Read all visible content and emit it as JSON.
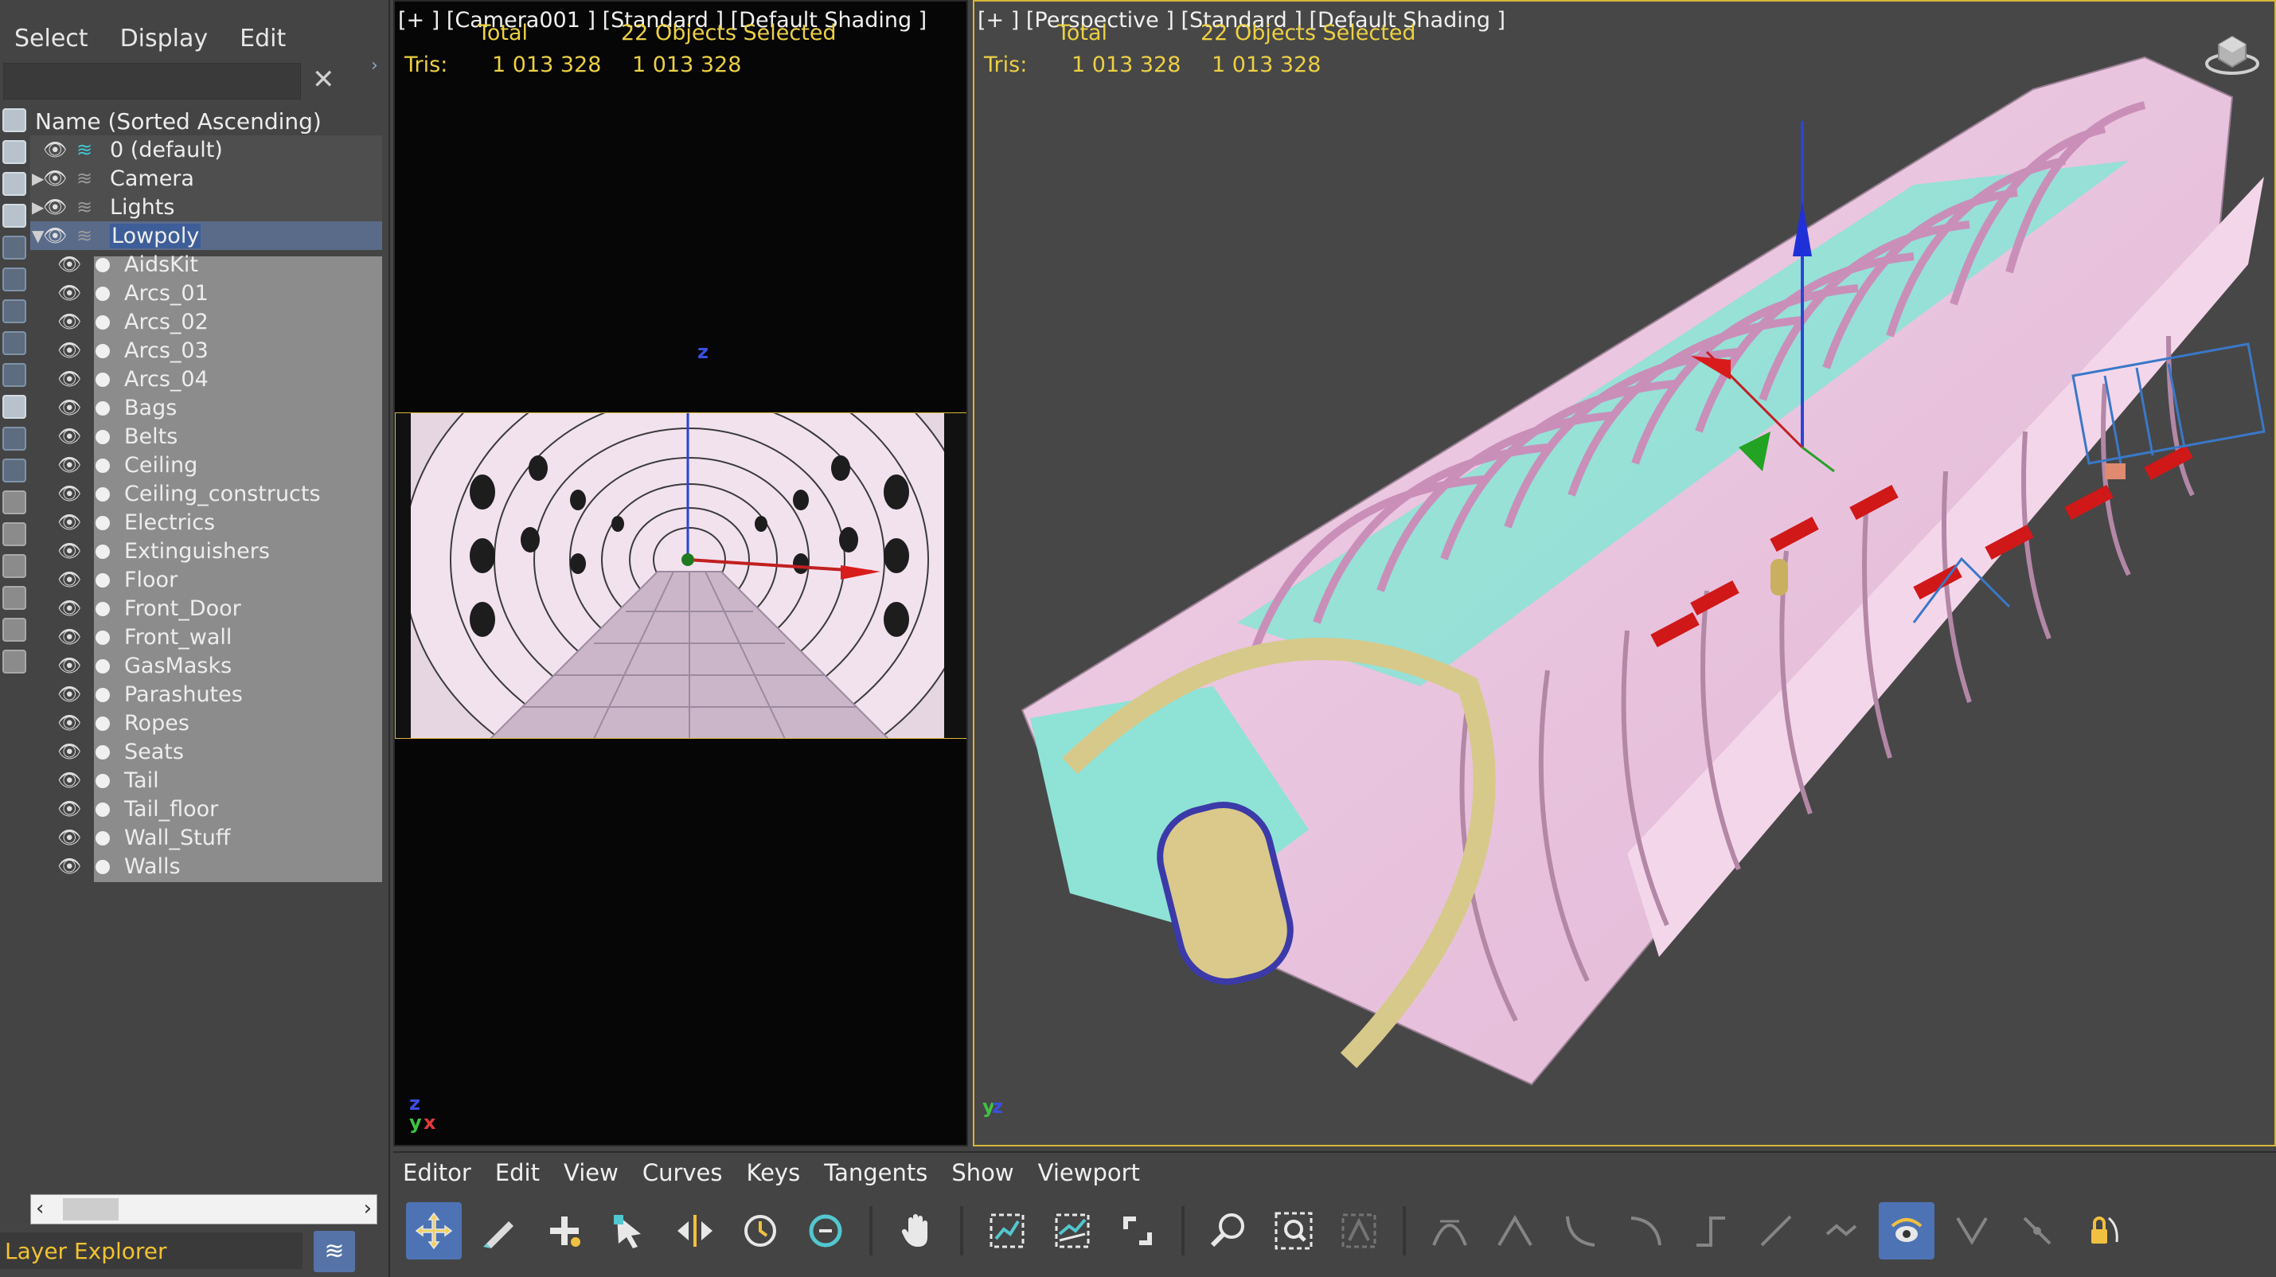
{
  "explorer": {
    "menu": [
      "Select",
      "Display",
      "Edit"
    ],
    "search_value": "",
    "header": "Name (Sorted Ascending)",
    "layers": [
      {
        "name": "0 (default)",
        "kind": "default"
      },
      {
        "name": "Camera",
        "kind": "collapsed"
      },
      {
        "name": "Lights",
        "kind": "collapsed"
      },
      {
        "name": "Lowpoly",
        "kind": "expanded",
        "selected": true
      }
    ],
    "objects": [
      "AidsKit",
      "Arcs_01",
      "Arcs_02",
      "Arcs_03",
      "Arcs_04",
      "Bags",
      "Belts",
      "Ceiling",
      "Ceiling_constructs",
      "Electrics",
      "Extinguishers",
      "Floor",
      "Front_Door",
      "Front_wall",
      "GasMasks",
      "Parashutes",
      "Ropes",
      "Seats",
      "Tail",
      "Tail_floor",
      "Wall_Stuff",
      "Walls"
    ],
    "footer_label": "Layer Explorer",
    "tool_icons": [
      "geometry-filter-icon",
      "shapes-filter-icon",
      "lights-filter-icon",
      "cameras-filter-icon",
      "helpers-filter-icon",
      "spacewarps-filter-icon",
      "groups-filter-icon",
      "xrefs-filter-icon",
      "bones-filter-icon",
      "containers-filter-icon",
      "frozen-filter-icon",
      "hidden-filter-icon",
      "all-filter-icon",
      "none-filter-icon",
      "invert-filter-icon",
      "display-children-icon",
      "filter-icon",
      "layer-toggle-icon"
    ]
  },
  "viewport_camera": {
    "label": "[+ ] [Camera001 ]  [Standard ] [Default Shading ]",
    "stat_total": "Total",
    "stat_selected": "22 Objects Selected",
    "tris_label": "Tris:",
    "tris_total": "1 013 328",
    "tris_selected": "1 013 328"
  },
  "viewport_perspective": {
    "label": "[+ ] [Perspective ]  [Standard ] [Default Shading ]",
    "stat_total": "Total",
    "stat_selected": "22 Objects Selected",
    "tris_label": "Tris:",
    "tris_total": "1 013 328",
    "tris_selected": "1 013 328"
  },
  "axes": {
    "x": "x",
    "y": "y",
    "z": "z"
  },
  "curve_editor": {
    "menu": [
      "Editor",
      "Edit",
      "View",
      "Curves",
      "Keys",
      "Tangents",
      "Show",
      "Viewport"
    ],
    "toolbar": [
      "move-keys-icon",
      "draw-curves-icon",
      "add-keys-icon",
      "select-keys-icon",
      "slide-keys-icon",
      "scale-keys-icon",
      "scale-values-icon",
      "pan-hand-icon",
      "zoom-selected-icon",
      "frame-keys-icon",
      "snap-icon",
      "zoom-icon",
      "zoom-region-icon",
      "isolate-icon",
      "tangent-auto-icon",
      "tangent-spline-icon",
      "tangent-fast-icon",
      "tangent-slow-icon",
      "tangent-step-icon",
      "tangent-linear-icon",
      "tangent-smooth-icon",
      "show-handles-icon",
      "break-tangents-icon",
      "unify-tangents-icon",
      "lock-tangents-icon"
    ]
  },
  "colors": {
    "accent_yellow": "#ecd043",
    "selection_blue": "#3d5e98",
    "active_button": "#4d73b4",
    "frame_pink": "#e4c3dc",
    "frame_cyan": "#8ee3d6",
    "frame_gold": "#d7c98a"
  }
}
